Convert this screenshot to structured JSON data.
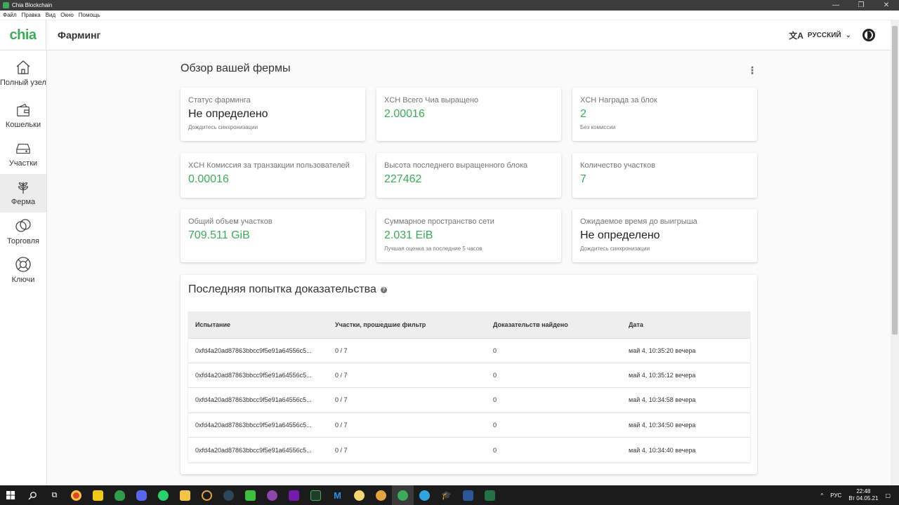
{
  "window": {
    "title": "Chia Blockchain"
  },
  "menu": [
    "Файл",
    "Правка",
    "Вид",
    "Окно",
    "Помощь"
  ],
  "header": {
    "logo": "chia",
    "page_title": "Фарминг",
    "language": "РУССКИЙ"
  },
  "sidebar": {
    "items": [
      {
        "label": "Полный узел",
        "icon": "home-icon"
      },
      {
        "label": "Кошельки",
        "icon": "wallet-icon"
      },
      {
        "label": "Участки",
        "icon": "hdd-icon"
      },
      {
        "label": "Ферма",
        "icon": "sprout-icon",
        "active": true
      },
      {
        "label": "Торговля",
        "icon": "circles-icon"
      },
      {
        "label": "Ключи",
        "icon": "lifebuoy-icon"
      }
    ]
  },
  "overview": {
    "title": "Обзор вашей фермы",
    "cards": [
      {
        "label": "Статус фарминга",
        "value": "Не определено",
        "sub": "Дождитесь синхронизации"
      },
      {
        "label": "XCH Всего Чиа выращено",
        "value": "2.00016",
        "sub": ""
      },
      {
        "label": "XCH Награда за блок",
        "value": "2",
        "sub": "Без комиссии"
      },
      {
        "label": "XCH Комиссия за транзакции пользователей",
        "value": "0.00016",
        "sub": ""
      },
      {
        "label": "Высота последнего выращенного блока",
        "value": "227462",
        "sub": ""
      },
      {
        "label": "Количество участков",
        "value": "7",
        "sub": ""
      },
      {
        "label": "Общий объем участков",
        "value": "709.511 GiB",
        "sub": ""
      },
      {
        "label": "Суммарное пространство сети",
        "value": "2.031 EiB",
        "sub": "Лучшая оценка за последние 5 часов"
      },
      {
        "label": "Ожидаемое время до выигрыша",
        "value": "Не определено",
        "sub": "Дождитесь синхронизации"
      }
    ]
  },
  "proofs": {
    "title": "Последняя попытка доказательства",
    "columns": [
      "Испытание",
      "Участки, прошедшие фильтр",
      "Доказательств найдено",
      "Дата"
    ],
    "rows": [
      [
        "0xfd4a20ad87863bbcc9f5e91a64556c5...",
        "0 / 7",
        "0",
        "май 4, 10:35:20 вечера"
      ],
      [
        "0xfd4a20ad87863bbcc9f5e91a64556c5...",
        "0 / 7",
        "0",
        "май 4, 10:35:12 вечера"
      ],
      [
        "0xfd4a20ad87863bbcc9f5e91a64556c5...",
        "0 / 7",
        "0",
        "май 4, 10:34:58 вечера"
      ],
      [
        "0xfd4a20ad87863bbcc9f5e91a64556c5...",
        "0 / 7",
        "0",
        "май 4, 10:34:50 вечера"
      ],
      [
        "0xfd4a20ad87863bbcc9f5e91a64556c5...",
        "0 / 7",
        "0",
        "май 4, 10:34:40 вечера"
      ]
    ]
  },
  "taskbar": {
    "lang": "РУС",
    "time": "22:48",
    "date": "Вт 04.05.21"
  },
  "colors": {
    "accent": "#3aac59"
  }
}
